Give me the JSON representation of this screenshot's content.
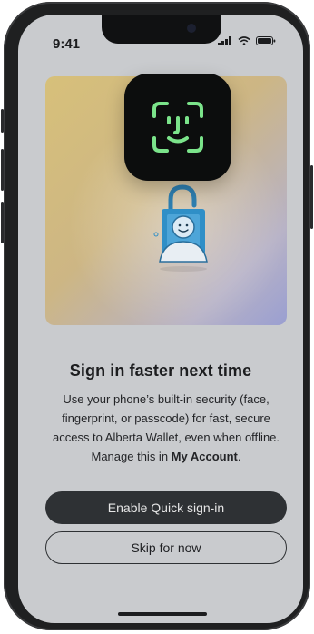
{
  "status_bar": {
    "time": "9:41"
  },
  "icons": {
    "signal": "cellular-signal-icon",
    "wifi": "wifi-icon",
    "battery": "battery-icon",
    "face_id": "face-id-icon",
    "lock_person": "lock-with-person-icon"
  },
  "onboarding": {
    "title": "Sign in faster next time",
    "body_prefix": "Use your phone’s built-in security (face, fingerprint, or passcode) for fast, secure access to Alberta Wallet, even when offline. Manage this in ",
    "body_link": "My Account",
    "body_suffix": "."
  },
  "actions": {
    "primary_label": "Enable Quick sign-in",
    "secondary_label": "Skip for now"
  },
  "colors": {
    "screen_overlay": "#c9cbce",
    "primary_button": "#2e3134",
    "face_id_green": "#7be38a",
    "illustration_blue": "#2f8fc7"
  }
}
